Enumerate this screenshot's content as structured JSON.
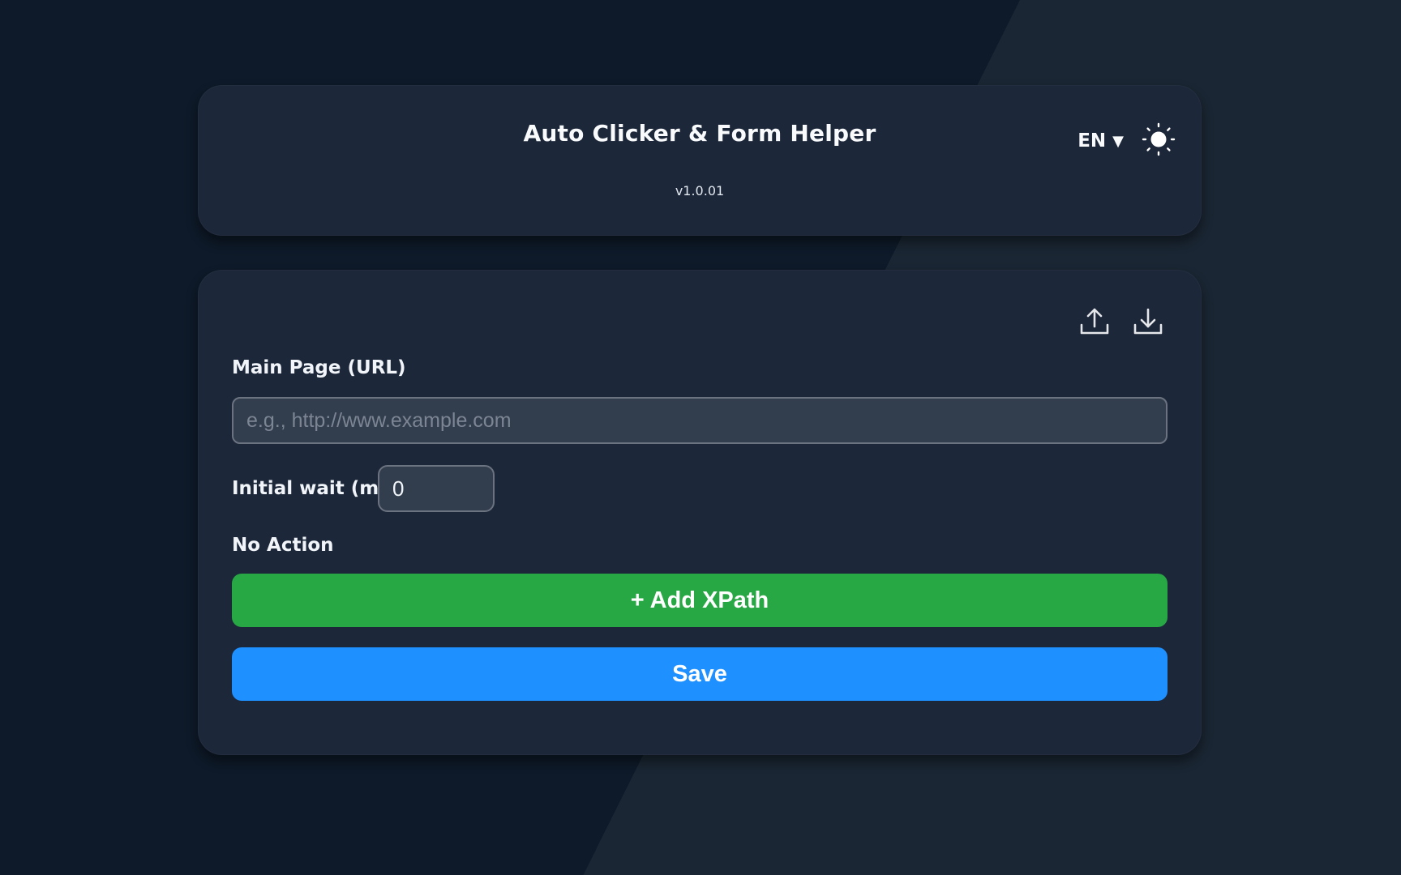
{
  "header": {
    "title": "Auto Clicker & Form Helper",
    "version": "v1.0.01",
    "language": "EN",
    "language_caret": "▼",
    "theme_icon": "sun-icon"
  },
  "toolbar": {
    "upload_icon": "upload-icon",
    "download_icon": "download-icon"
  },
  "form": {
    "url_label": "Main Page (URL)",
    "url_value": "",
    "url_placeholder": "e.g., http://www.example.com",
    "wait_label": "Initial wait (ms)",
    "wait_value": "0",
    "no_action_text": "No Action",
    "add_xpath_label": "+ Add XPath",
    "save_label": "Save"
  },
  "colors": {
    "background_dark": "#0e1a29",
    "background_light": "#1a2633",
    "card": "#1c2739",
    "input_bg": "#323d4d",
    "add_button": "#28a745",
    "save_button": "#1e90ff"
  }
}
